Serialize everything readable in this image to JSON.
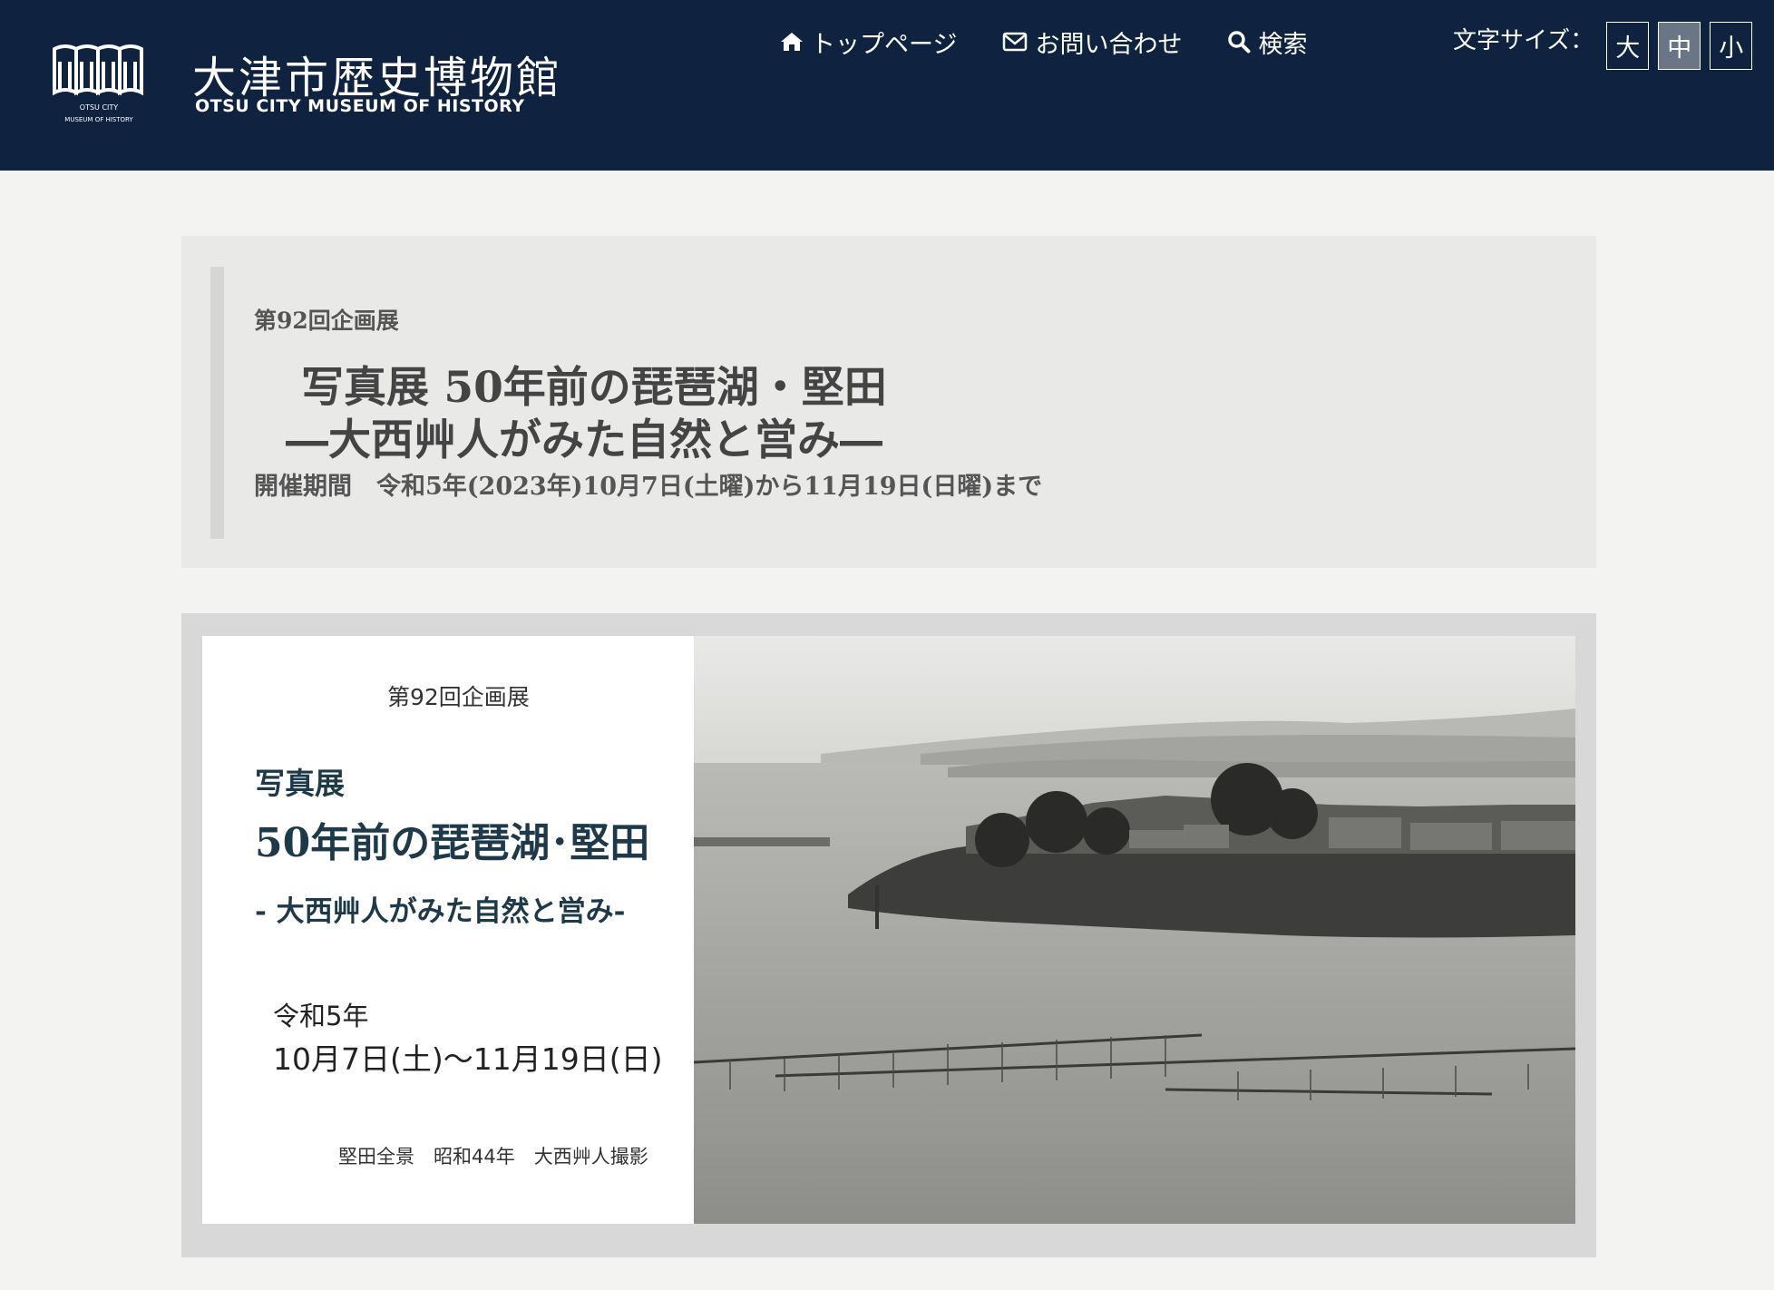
{
  "header": {
    "logo_ja": "大津市歴史博物館",
    "logo_en": "OTSU CITY MUSEUM OF HISTORY",
    "logo_mark_text": "OTSU CITY MUSEUM OF HISTORY",
    "background_color": "#0f2340"
  },
  "nav": {
    "items": [
      {
        "icon": "home-icon",
        "label": "トップページ"
      },
      {
        "icon": "mail-icon",
        "label": "お問い合わせ"
      },
      {
        "icon": "search-icon",
        "label": "検索"
      }
    ]
  },
  "font_size": {
    "label": "文字サイズ：",
    "options": [
      "大",
      "中",
      "小"
    ],
    "selected": "中"
  },
  "exhibition": {
    "subtitle": "第92回企画展",
    "title_line1": "写真展 50年前の琵琶湖・堅田",
    "title_line2": "―大西艸人がみた自然と営み―",
    "period": "開催期間　令和5年(2023年)10月7日(土曜)から11月19日(日曜)まで"
  },
  "poster": {
    "subtitle": "第92回企画展",
    "label": "写真展",
    "title": "50年前の琵琶湖･堅田",
    "tagline": "- 大西艸人がみた自然と営み-",
    "era": "令和5年",
    "dates": "10月7日(土)～11月19日(日)",
    "credit": "堅田全景　昭和44年　大西艸人撮影"
  }
}
